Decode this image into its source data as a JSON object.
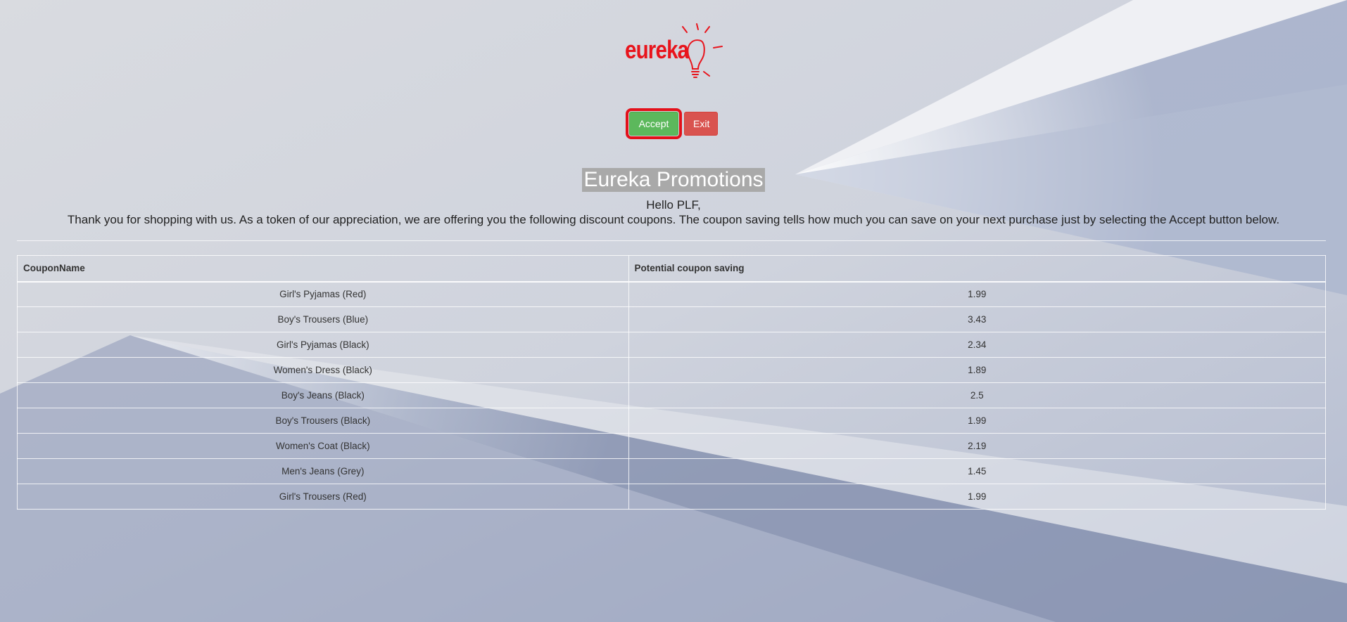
{
  "logo": {
    "text": "eureka"
  },
  "actions": {
    "accept_label": "Accept",
    "exit_label": "Exit"
  },
  "heading": {
    "title": "Eureka Promotions",
    "greeting": "Hello PLF,",
    "intro": "Thank you for shopping with us. As a token of our appreciation, we are offering you the following discount coupons. The coupon saving tells how much you can save on your next purchase just by selecting the Accept button below."
  },
  "table": {
    "columns": [
      "CouponName",
      "Potential coupon saving"
    ],
    "rows": [
      {
        "name": "Girl's Pyjamas (Red)",
        "saving": "1.99"
      },
      {
        "name": "Boy's Trousers (Blue)",
        "saving": "3.43"
      },
      {
        "name": "Girl's Pyjamas (Black)",
        "saving": "2.34"
      },
      {
        "name": "Women's Dress (Black)",
        "saving": "1.89"
      },
      {
        "name": "Boy's Jeans (Black)",
        "saving": "2.5"
      },
      {
        "name": "Boy's Trousers (Black)",
        "saving": "1.99"
      },
      {
        "name": "Women's Coat (Black)",
        "saving": "2.19"
      },
      {
        "name": "Men's Jeans (Grey)",
        "saving": "1.45"
      },
      {
        "name": "Girl's Trousers (Red)",
        "saving": "1.99"
      }
    ]
  },
  "colors": {
    "brand": "#e8141c",
    "accept": "#5cb85c",
    "exit": "#d9534f",
    "highlight_outline": "#e3101a",
    "title_highlight": "#a9a9a9"
  }
}
